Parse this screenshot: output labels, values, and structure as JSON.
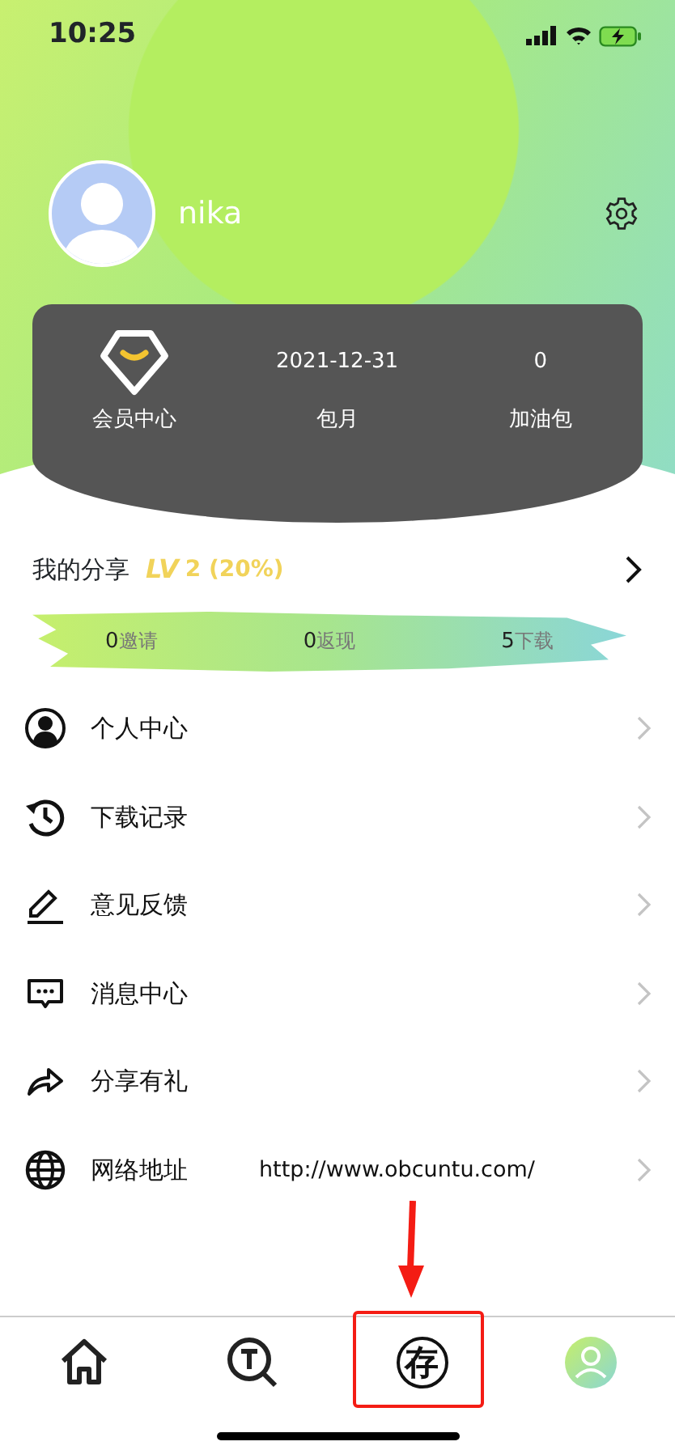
{
  "status_bar": {
    "time": "10:25"
  },
  "profile": {
    "username": "nika"
  },
  "membership": [
    {
      "kind": "badge",
      "label": "会员中心"
    },
    {
      "kind": "value",
      "value": "2021-12-31",
      "label": "包月"
    },
    {
      "kind": "value",
      "value": "0",
      "label": "加油包"
    }
  ],
  "share": {
    "title": "我的分享",
    "level_prefix": "LV",
    "level_text": "2 (20%)",
    "stats": [
      {
        "count": "0",
        "label": "邀请"
      },
      {
        "count": "0",
        "label": "返现"
      },
      {
        "count": "5",
        "label": "下载"
      }
    ]
  },
  "menu": [
    {
      "kind": "user",
      "label": "个人中心"
    },
    {
      "kind": "history",
      "label": "下载记录"
    },
    {
      "kind": "pencil",
      "label": "意见反馈"
    },
    {
      "kind": "message",
      "label": "消息中心"
    },
    {
      "kind": "share",
      "label": "分享有礼"
    },
    {
      "kind": "globe",
      "label": "网络地址",
      "value": "http://www.obcuntu.com/"
    }
  ],
  "tabs": [
    {
      "kind": "home",
      "selected": false
    },
    {
      "kind": "search",
      "selected": false
    },
    {
      "kind": "glyph",
      "glyph": "存",
      "selected": false
    },
    {
      "kind": "profile",
      "selected": true
    }
  ]
}
